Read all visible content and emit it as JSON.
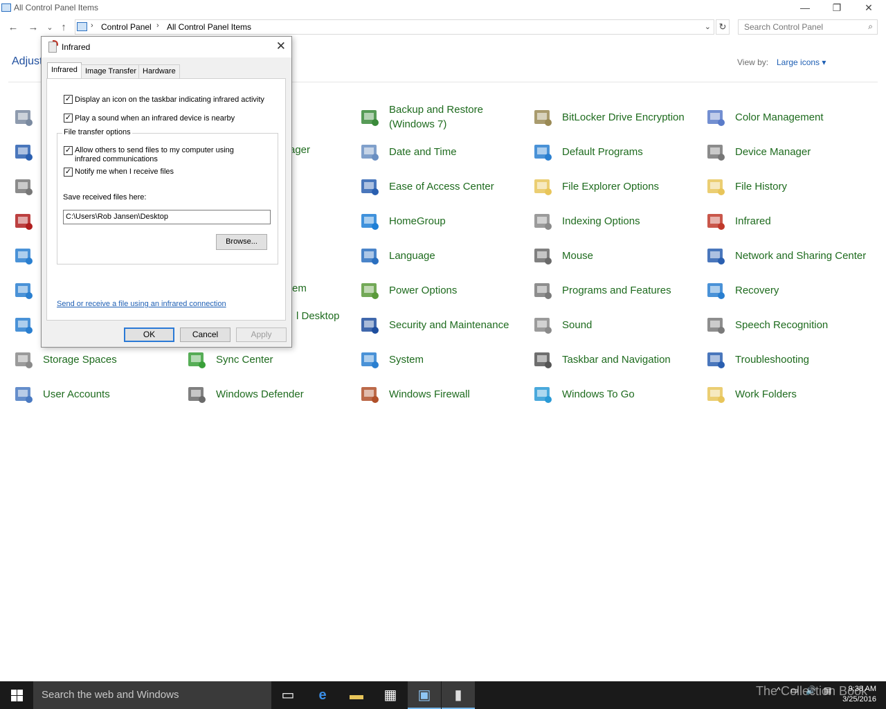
{
  "window": {
    "title": "All Control Panel Items",
    "controls": {
      "minimize": "—",
      "restore": "❐",
      "close": "✕"
    }
  },
  "nav": {
    "back": "←",
    "forward": "→",
    "recent": "⌄",
    "up": "↑",
    "breadcrumbs": [
      "Control Panel",
      "All Control Panel Items"
    ],
    "separator": "›",
    "refresh": "↻",
    "search_placeholder": "Search Control Panel"
  },
  "header": {
    "adjust_partial": "Adjust",
    "view_by_label": "View by:",
    "view_by_value": "Large icons ▾"
  },
  "items": [
    {
      "label": "Backup and Restore (Windows 7)",
      "icon": "backup-icon",
      "color": "#3a8a3a"
    },
    {
      "label": "BitLocker Drive Encryption",
      "icon": "key-icon",
      "color": "#9a8a55"
    },
    {
      "label": "Color Management",
      "icon": "color-icon",
      "color": "#5a7bc9"
    },
    {
      "label": "Date and Time",
      "icon": "calendar-icon",
      "color": "#6a8fc2"
    },
    {
      "label": "Default Programs",
      "icon": "default-programs-icon",
      "color": "#2a7fd0"
    },
    {
      "label": "Device Manager",
      "icon": "device-manager-icon",
      "color": "#777777"
    },
    {
      "label": "Ease of Access Center",
      "icon": "ease-of-access-icon",
      "color": "#2a5fb0"
    },
    {
      "label": "File Explorer Options",
      "icon": "folder-options-icon",
      "color": "#e8c55a"
    },
    {
      "label": "File History",
      "icon": "file-history-icon",
      "color": "#e8c55a"
    },
    {
      "label": "HomeGroup",
      "icon": "homegroup-icon",
      "color": "#1e7fd6"
    },
    {
      "label": "Indexing Options",
      "icon": "indexing-icon",
      "color": "#8a8a8a"
    },
    {
      "label": "Infrared",
      "icon": "infrared-icon",
      "color": "#c0392b"
    },
    {
      "label": "Language",
      "icon": "language-icon",
      "color": "#2a6fbf"
    },
    {
      "label": "Mouse",
      "icon": "mouse-icon",
      "color": "#6a6a6a"
    },
    {
      "label": "Network and Sharing Center",
      "icon": "network-icon",
      "color": "#2a5fb0"
    },
    {
      "label": "Power Options",
      "icon": "power-icon",
      "color": "#5a9a3a"
    },
    {
      "label": "Programs and Features",
      "icon": "programs-icon",
      "color": "#7a7a7a"
    },
    {
      "label": "Recovery",
      "icon": "recovery-icon",
      "color": "#2a7fd0"
    },
    {
      "label": "Security and Maintenance",
      "icon": "flag-icon",
      "color": "#1e4e9e"
    },
    {
      "label": "Sound",
      "icon": "speaker-icon",
      "color": "#8a8a8a"
    },
    {
      "label": "Speech Recognition",
      "icon": "microphone-icon",
      "color": "#7a7a7a"
    },
    {
      "label": "System",
      "icon": "system-icon",
      "color": "#2a7fd0"
    },
    {
      "label": "Taskbar and Navigation",
      "icon": "taskbar-icon",
      "color": "#555555"
    },
    {
      "label": "Troubleshooting",
      "icon": "troubleshooting-icon",
      "color": "#2a5fb0"
    },
    {
      "label": "Storage Spaces",
      "icon": "storage-icon",
      "color": "#8a8a8a"
    },
    {
      "label": "Sync Center",
      "icon": "sync-icon",
      "color": "#3aa03a"
    },
    {
      "label": "User Accounts",
      "icon": "users-icon",
      "color": "#4a7ac2"
    },
    {
      "label": "Windows Defender",
      "icon": "defender-icon",
      "color": "#6a6a6a"
    },
    {
      "label": "Windows Firewall",
      "icon": "firewall-icon",
      "color": "#b0502a"
    },
    {
      "label": "Windows To Go",
      "icon": "windows-to-go-icon",
      "color": "#2a9ad6"
    },
    {
      "label": "Work Folders",
      "icon": "work-folders-icon",
      "color": "#e8c55a"
    }
  ],
  "partial_items": [
    {
      "label": "ager",
      "icon": ""
    },
    {
      "label": "em",
      "icon": ""
    },
    {
      "label": "l Desktop",
      "icon": ""
    }
  ],
  "left_icons": [
    {
      "icon": "administrative-tools-icon",
      "color": "#7a8aa0"
    },
    {
      "icon": "autoplay-icon",
      "color": "#2a5fb0"
    },
    {
      "icon": "credential-manager-icon",
      "color": "#777777"
    },
    {
      "icon": "flash-player-icon",
      "color": "#b01e1e"
    },
    {
      "icon": "internet-options-icon",
      "color": "#2a7fd0"
    },
    {
      "icon": "display-icon",
      "color": "#2a7fd0"
    },
    {
      "icon": "region-icon",
      "color": "#2a7fd0"
    }
  ],
  "dialog": {
    "title": "Infrared",
    "close": "✕",
    "tabs": [
      "Infrared",
      "Image Transfer",
      "Hardware"
    ],
    "check_mark": "✓",
    "options": [
      "Display an icon on the taskbar indicating infrared activity",
      "Play a sound when an infrared device is nearby"
    ],
    "group_title": "File transfer options",
    "group_options": [
      "Allow others to send files to my computer using infrared communications",
      "Notify me when I receive files"
    ],
    "save_label": "Save received files here:",
    "save_path": "C:\\Users\\Rob Jansen\\Desktop",
    "browse": "Browse...",
    "link": "Send or receive a file using an infrared connection",
    "ok": "OK",
    "cancel": "Cancel",
    "apply": "Apply"
  },
  "taskbar": {
    "search_placeholder": "Search the web and Windows",
    "task_view": "▭",
    "edge": "e",
    "explorer": "▬",
    "store": "▦",
    "control_panel": "▣",
    "infrared": "▮",
    "tray": [
      "^",
      "▭",
      "🔊",
      "▤"
    ],
    "watermark": "The Collection Book",
    "time": "9:38 AM",
    "date": "3/25/2016"
  }
}
